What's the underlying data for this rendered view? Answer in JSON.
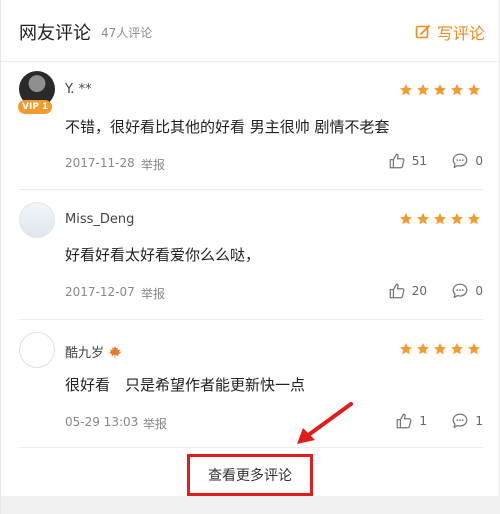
{
  "header": {
    "title": "网友评论",
    "count": "47人评论",
    "write_label": "写评论",
    "accent_color": "#f08a1c"
  },
  "comments": [
    {
      "name": "Y. **",
      "badge": "VIP 1",
      "stars": 5,
      "text": "不错，很好看比其他的好看 男主很帅 剧情不老套",
      "date": "2017-11-28",
      "report": "举报",
      "likes": "51",
      "replies": "0"
    },
    {
      "name": "Miss_Deng",
      "stars": 5,
      "text": "好看好看太好看爱你么么哒，",
      "date": "2017-12-07",
      "report": "举报",
      "likes": "20",
      "replies": "0"
    },
    {
      "name": "酷九岁",
      "stars": 5,
      "text": "很好看　只是希望作者能更新快一点",
      "date": "05-29 13:03",
      "report": "举报",
      "likes": "1",
      "replies": "1"
    }
  ],
  "more": {
    "label": "查看更多评论",
    "highlight_color": "#e31b1b"
  },
  "icons": {
    "write": "edit-icon",
    "star": "star-icon",
    "like": "thumbs-up-icon",
    "reply": "comment-bubble-icon",
    "maple": "maple-leaf-icon"
  }
}
